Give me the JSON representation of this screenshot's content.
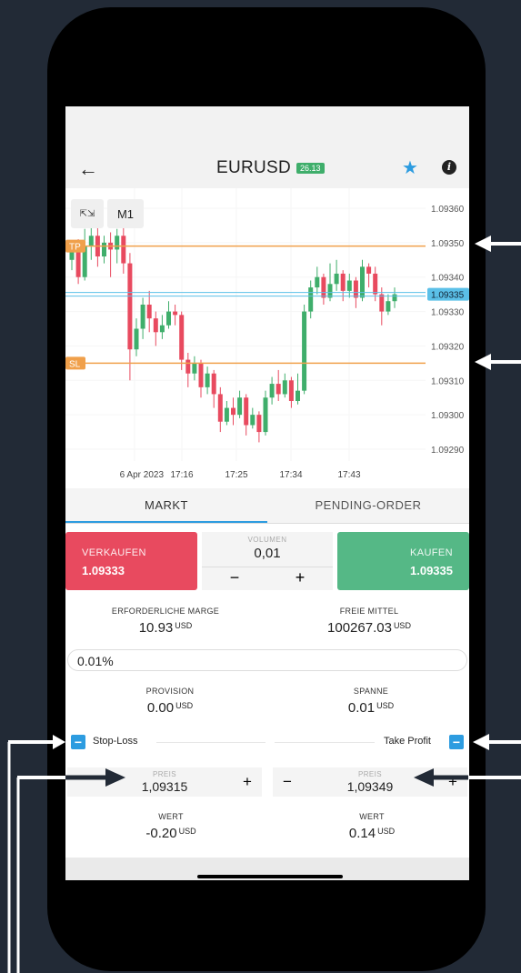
{
  "header": {
    "title": "EURUSD",
    "badge": "26.13"
  },
  "chart": {
    "timeframe": "M1",
    "y_ticks": [
      "1.09360",
      "1.09350",
      "1.09340",
      "1.09330",
      "1.09320",
      "1.09310",
      "1.09300",
      "1.09290"
    ],
    "current_price": "1.09335",
    "tp_label": "TP",
    "sl_label": "SL",
    "x_ticks": [
      "6 Apr 2023",
      "17:16",
      "17:25",
      "17:34",
      "17:43"
    ],
    "colors": {
      "up": "#3fae6b",
      "down": "#e84a5f",
      "tp_sl_line": "#f0a04b",
      "price_line": "#5bc0e8"
    }
  },
  "tabs": {
    "market": "MARKT",
    "pending": "PENDING-ORDER"
  },
  "trade": {
    "sell_label": "VERKAUFEN",
    "sell_price": "1.09333",
    "buy_label": "KAUFEN",
    "buy_price": "1.09335",
    "volume_label": "VOLUMEN",
    "volume_value": "0,01",
    "minus": "−",
    "plus": "+"
  },
  "stats": {
    "margin_label": "ERFORDERLICHE MARGE",
    "margin_value": "10.93",
    "margin_unit": "USD",
    "free_label": "FREIE MITTEL",
    "free_value": "100267.03",
    "free_unit": "USD",
    "percent": "0.01%",
    "commission_label": "PROVISION",
    "commission_value": "0.00",
    "commission_unit": "USD",
    "spread_label": "SPANNE",
    "spread_value": "0.01",
    "spread_unit": "USD"
  },
  "stop_loss": {
    "label": "Stop-Loss",
    "toggle": "−",
    "price_label": "PREIS",
    "price": "1,09315",
    "plus": "+",
    "value_label": "WERT",
    "value": "-0.20",
    "unit": "USD"
  },
  "take_profit": {
    "label": "Take Profit",
    "toggle": "−",
    "price_label": "PREIS",
    "price": "1,09349",
    "minus": "−",
    "plus": "+",
    "value_label": "WERT",
    "value": "0.14",
    "unit": "USD"
  }
}
